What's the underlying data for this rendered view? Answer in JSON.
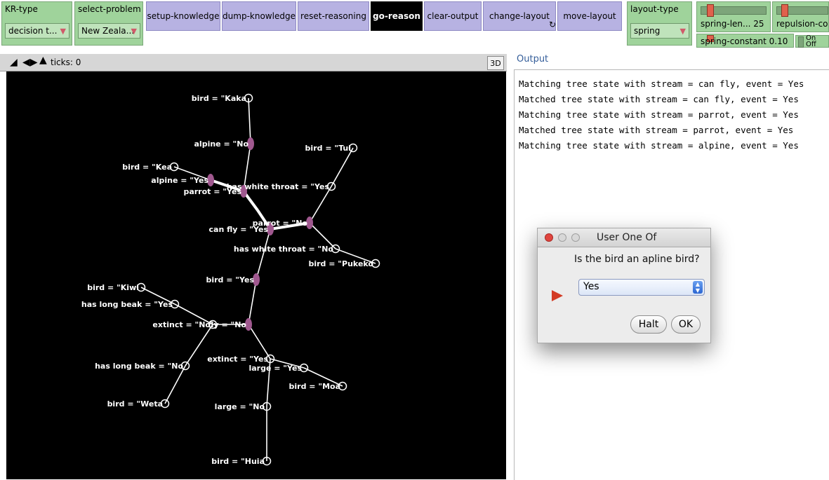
{
  "toolbar": {
    "kr_type": {
      "label": "KR-type",
      "value": "decision t..."
    },
    "select_problem": {
      "label": "select-problem",
      "value": "New Zeala..."
    },
    "buttons": {
      "setup": "setup-knowledge",
      "dump": "dump-knowledge",
      "reset": "reset-reasoning",
      "go": "go-reason",
      "clear": "clear-output",
      "change_layout": "change-layout",
      "move_layout": "move-layout"
    },
    "layout_type": {
      "label": "layout-type",
      "value": "spring"
    },
    "sliders": {
      "spring_length": {
        "label": "spring-len... 25"
      },
      "repulsion": {
        "label": "repulsion-co"
      },
      "spring_constant": {
        "label": "spring-constant 0.10"
      }
    },
    "switch": {
      "on": "On",
      "off": "Off"
    }
  },
  "view": {
    "ticks": "ticks: 0",
    "btn_3d": "3D",
    "graph": {
      "edges": [
        [
          "root",
          "yes1"
        ],
        [
          "root",
          "no1"
        ],
        [
          "no1",
          "pukeko_node"
        ],
        [
          "no1",
          "tui_node"
        ],
        [
          "pukeko_node",
          "pukeko"
        ],
        [
          "tui_node",
          "tui"
        ],
        [
          "yes1",
          "parrot"
        ],
        [
          "parrot",
          "alpine_no"
        ],
        [
          "parrot",
          "alpine_yes"
        ],
        [
          "alpine_no",
          "kaka"
        ],
        [
          "alpine_yes",
          "kea"
        ],
        [
          "root",
          "birdyes"
        ],
        [
          "birdyes",
          "flyno"
        ],
        [
          "flyno",
          "extinct_no"
        ],
        [
          "extinct_no",
          "longbeak_yes"
        ],
        [
          "extinct_no",
          "longbeak_no"
        ],
        [
          "longbeak_yes",
          "kiwi"
        ],
        [
          "longbeak_no",
          "weta"
        ],
        [
          "flyno",
          "extinct_yes"
        ],
        [
          "extinct_yes",
          "large_yes"
        ],
        [
          "extinct_yes",
          "large_no"
        ],
        [
          "large_yes",
          "moa"
        ],
        [
          "large_no",
          "huia"
        ]
      ],
      "labels": [
        {
          "node": "kaka",
          "text": "bird = \"Kaka"
        },
        {
          "node": "alpine_no",
          "text": "alpine = \"No"
        },
        {
          "node": "tui",
          "text": "bird = \"Tui"
        },
        {
          "node": "kea",
          "text": "bird = \"Kea"
        },
        {
          "node": "alpine_yes",
          "text": "alpine = \"Yes"
        },
        {
          "node": "tui_node",
          "text": "has white throat = \"Yes"
        },
        {
          "node": "parrot",
          "text": "parrot = \"Yes"
        },
        {
          "node": "root",
          "text": "can fly = \"Yes"
        },
        {
          "node": "no1",
          "text": "parrot = \"No"
        },
        {
          "node": "pukeko_node",
          "text": "has white throat = \"No"
        },
        {
          "node": "pukeko",
          "text": "bird = \"Pukeko"
        },
        {
          "node": "birdyes",
          "text": "bird = \"Yes"
        },
        {
          "node": "kiwi",
          "text": "bird = \"Kiwi"
        },
        {
          "node": "longbeak_yes",
          "text": "has long beak = \"Yes"
        },
        {
          "node": "extinct_no",
          "text": "extinct = \"No"
        },
        {
          "node": "flyno",
          "text": "fly = \"No"
        },
        {
          "node": "extinct_yes",
          "text": "extinct = \"Yes"
        },
        {
          "node": "large_yes",
          "text": "large = \"Yes"
        },
        {
          "node": "longbeak_no",
          "text": "has long beak = \"No"
        },
        {
          "node": "moa",
          "text": "bird = \"Moa"
        },
        {
          "node": "weta",
          "text": "bird = \"Weta"
        },
        {
          "node": "large_no",
          "text": "large = \"No"
        },
        {
          "node": "huia",
          "text": "bird = \"Huia"
        }
      ]
    }
  },
  "output": {
    "label": "Output",
    "lines": [
      "Matching tree state with stream = can fly, event = Yes",
      "Matched tree state with stream = can fly, event = Yes",
      "Matching tree state with stream = parrot, event = Yes",
      "Matched tree state with stream = parrot, event = Yes",
      "Matching tree state with stream = alpine, event = Yes"
    ]
  },
  "dialog": {
    "title": "User One Of",
    "question": "Is the bird an apline bird?",
    "selected": "Yes",
    "halt": "Halt",
    "ok": "OK"
  },
  "colors": {
    "chooser": "#9fd39b",
    "button": "#b7b2e2",
    "node_active": "#a0588f",
    "view_bg": "#000000"
  }
}
